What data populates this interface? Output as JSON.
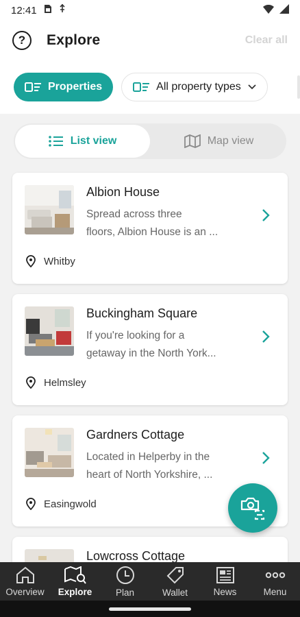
{
  "status_bar": {
    "time": "12:41"
  },
  "header": {
    "title": "Explore",
    "clear_label": "Clear all"
  },
  "filters": {
    "properties_label": "Properties",
    "types_label": "All property types"
  },
  "view_toggle": {
    "list_label": "List view",
    "map_label": "Map view"
  },
  "properties": [
    {
      "name": "Albion House",
      "desc1": "Spread across three",
      "desc2": "floors, Albion House is an ...",
      "location": "Whitby"
    },
    {
      "name": "Buckingham Square",
      "desc1": "If you're looking for a",
      "desc2": "getaway in the North York...",
      "location": "Helmsley"
    },
    {
      "name": "Gardners Cottage",
      "desc1": "Located in Helperby in the",
      "desc2": "heart of North Yorkshire, ...",
      "location": "Easingwold"
    },
    {
      "name": "Lowcross Cottage"
    }
  ],
  "bottom_nav": [
    {
      "label": "Overview",
      "icon": "home-icon"
    },
    {
      "label": "Explore",
      "icon": "map-search-icon",
      "active": true
    },
    {
      "label": "Plan",
      "icon": "clock-icon"
    },
    {
      "label": "Wallet",
      "icon": "tag-icon"
    },
    {
      "label": "News",
      "icon": "newspaper-icon"
    },
    {
      "label": "Menu",
      "icon": "more-icon"
    }
  ],
  "colors": {
    "accent": "#1aa39a",
    "nav_bg": "#2a2a2a"
  }
}
